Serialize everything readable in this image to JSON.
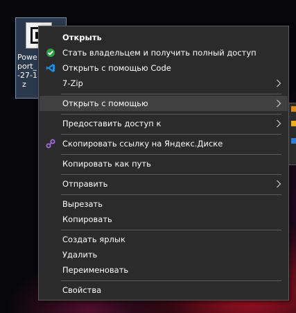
{
  "desktop": {
    "file_name": "Powe\nport_\n-27-1\n  z"
  },
  "menu": {
    "items": [
      {
        "label": "Открыть",
        "bold": true
      },
      {
        "label": "Стать владельцем и получить полный доступ",
        "icon": "shield-check-icon"
      },
      {
        "label": "Открыть с помощью Code",
        "icon": "vscode-icon"
      },
      {
        "label": "7-Zip",
        "submenu": true
      },
      {
        "label": "Открыть с помощью",
        "submenu": true,
        "highlighted": true
      },
      {
        "label": "Предоставить доступ к",
        "submenu": true
      },
      {
        "label": "Скопировать ссылку на Яндекс.Диске",
        "icon": "link-icon"
      },
      {
        "label": "Копировать как путь"
      },
      {
        "label": "Отправить",
        "submenu": true
      },
      {
        "label": "Вырезать"
      },
      {
        "label": "Копировать"
      },
      {
        "label": "Создать ярлык"
      },
      {
        "label": "Удалить"
      },
      {
        "label": "Переименовать"
      },
      {
        "label": "Свойства"
      }
    ]
  },
  "colors": {
    "menu_bg": "#2b2b2b",
    "hover_bg": "#414141",
    "text": "#ffffff",
    "shield_green": "#2ea043",
    "vscode_blue": "#1e8fe1",
    "link_purple": "#a56de2"
  }
}
